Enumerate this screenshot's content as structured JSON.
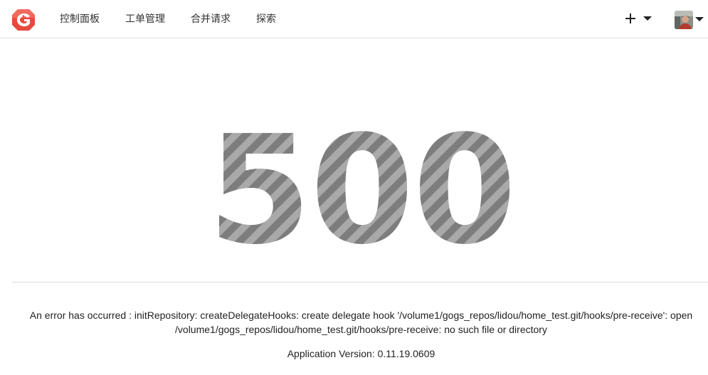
{
  "nav": {
    "items": [
      {
        "label": "控制面板"
      },
      {
        "label": "工单管理"
      },
      {
        "label": "合并请求"
      },
      {
        "label": "探索"
      }
    ],
    "create_icon": "plus-icon",
    "user_icon": "avatar"
  },
  "error": {
    "code": "500",
    "message": "An error has occurred : initRepository: createDelegateHooks: create delegate hook '/volume1/gogs_repos/lidou/home_test.git/hooks/pre-receive': open /volume1/gogs_repos/lidou/home_test.git/hooks/pre-receive: no such file or directory",
    "version": "Application Version: 0.11.19.0609"
  },
  "colors": {
    "logo": "#e84a3f",
    "stripe_dark": "#7d7d7d",
    "stripe_light": "#a9a9a9"
  }
}
